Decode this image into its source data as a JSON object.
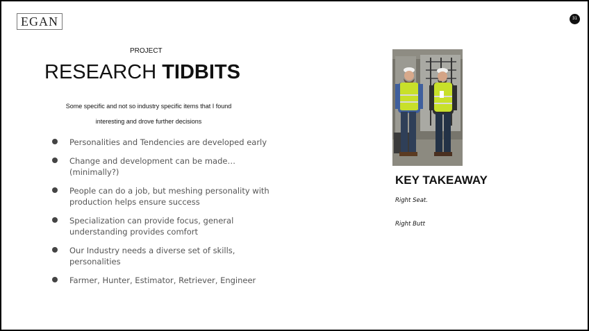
{
  "logo": "EGAN",
  "page_number": "31",
  "eyebrow": "PROJECT",
  "title": {
    "regular": "RESEARCH ",
    "bold": "TIDBITS"
  },
  "subtitle": [
    "Some specific and not so industry specific items that I found",
    "interesting and drove further decisions"
  ],
  "bullets": [
    "Personalities and Tendencies are developed early",
    "Change and development can be made…(minimally?)",
    "People can do a job, but meshing personality with production helps ensure success",
    "Specialization can provide focus, general understanding provides comfort",
    "Our Industry needs a diverse set of skills, personalities",
    "Farmer, Hunter, Estimator, Retriever, Engineer"
  ],
  "key_takeaway": {
    "heading": "KEY TAKEAWAY",
    "lines": [
      "Right Seat.",
      "Right Butt"
    ]
  },
  "colors": {
    "bullet_text": "#555555",
    "bullet_dot": "#444444",
    "badge": "#111111",
    "vest": "#c8e02a"
  }
}
